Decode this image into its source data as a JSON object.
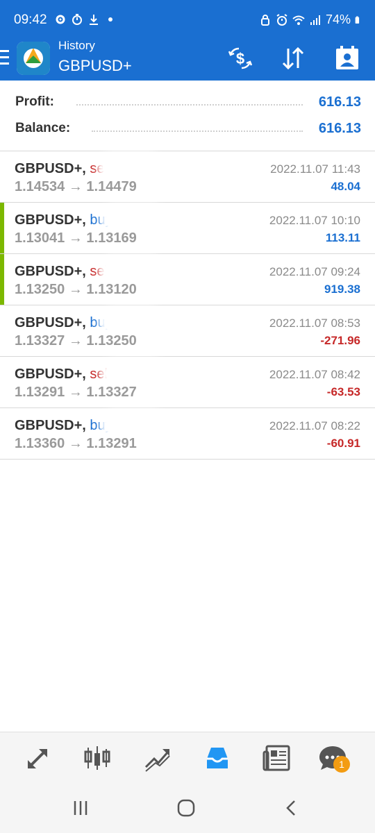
{
  "status_bar": {
    "time": "09:42",
    "battery": "74%"
  },
  "app_bar": {
    "subtitle": "History",
    "title": "GBPUSD+",
    "icons": [
      "exchange-dollar-icon",
      "sort-icon",
      "account-icon"
    ]
  },
  "summary": {
    "profit_label": "Profit:",
    "profit_value": "616.13",
    "balance_label": "Balance:",
    "balance_value": "616.13"
  },
  "deals": [
    {
      "symbol": "GBPUSD+,",
      "type": "sell",
      "prices": "1.14534 → 1.14479",
      "time": "2022.11.07 11:43",
      "profit": "48.04",
      "profit_sign": "pos",
      "marked": false
    },
    {
      "symbol": "GBPUSD+,",
      "type": "buy",
      "prices": "1.13041 → 1.13169",
      "time": "2022.11.07 10:10",
      "profit": "113.11",
      "profit_sign": "pos",
      "marked": true
    },
    {
      "symbol": "GBPUSD+,",
      "type": "sell",
      "prices": "1.13250 → 1.13120",
      "time": "2022.11.07 09:24",
      "profit": "919.38",
      "profit_sign": "pos",
      "marked": true
    },
    {
      "symbol": "GBPUSD+,",
      "type": "buy",
      "prices": "1.13327 → 1.13250",
      "time": "2022.11.07 08:53",
      "profit": "-271.96",
      "profit_sign": "neg",
      "marked": false
    },
    {
      "symbol": "GBPUSD+,",
      "type": "sell",
      "prices": "1.13291 → 1.13327",
      "time": "2022.11.07 08:42",
      "profit": "-63.53",
      "profit_sign": "neg",
      "marked": false
    },
    {
      "symbol": "GBPUSD+,",
      "type": "buy",
      "prices": "1.13360 → 1.13291",
      "time": "2022.11.07 08:22",
      "profit": "-60.91",
      "profit_sign": "neg",
      "marked": false
    }
  ],
  "bottom_nav": {
    "items": [
      "quotes-icon",
      "chart-icon",
      "trade-icon",
      "history-icon",
      "news-icon",
      "messages-icon"
    ],
    "active": "history-icon",
    "messages_badge": "1"
  },
  "colors": {
    "primary": "#1a6fd1",
    "sell": "#c62828",
    "marker": "#7cb800",
    "badge": "#f39c12"
  }
}
